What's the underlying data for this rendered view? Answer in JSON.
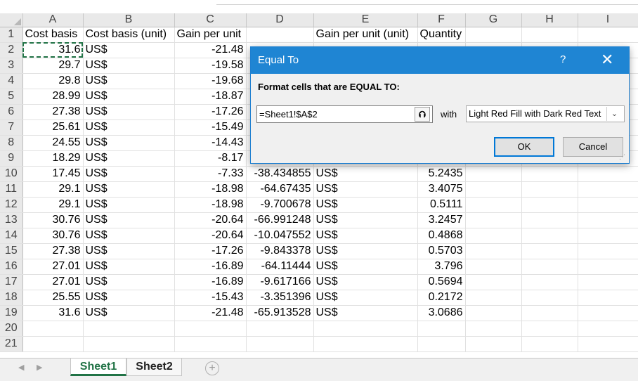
{
  "sheet": {
    "columns": [
      "A",
      "B",
      "C",
      "D",
      "E",
      "F",
      "G",
      "H",
      "I"
    ],
    "rows": [
      {
        "n": "1",
        "a": "Cost basis",
        "b": "Cost basis (unit)",
        "c": "Gain per unit",
        "d": "",
        "e": "Gain per unit (unit)",
        "f": "Quantity"
      },
      {
        "n": "2",
        "a": "31.6",
        "b": "US$",
        "c": "-21.48",
        "d": "",
        "e": "",
        "f": ""
      },
      {
        "n": "3",
        "a": "29.7",
        "b": "US$",
        "c": "-19.58",
        "d": "",
        "e": "",
        "f": ""
      },
      {
        "n": "4",
        "a": "29.8",
        "b": "US$",
        "c": "-19.68",
        "d": "",
        "e": "",
        "f": ""
      },
      {
        "n": "5",
        "a": "28.99",
        "b": "US$",
        "c": "-18.87",
        "d": "",
        "e": "",
        "f": ""
      },
      {
        "n": "6",
        "a": "27.38",
        "b": "US$",
        "c": "-17.26",
        "d": "",
        "e": "",
        "f": ""
      },
      {
        "n": "7",
        "a": "25.61",
        "b": "US$",
        "c": "-15.49",
        "d": "",
        "e": "",
        "f": ""
      },
      {
        "n": "8",
        "a": "24.55",
        "b": "US$",
        "c": "-14.43",
        "d": "",
        "e": "",
        "f": ""
      },
      {
        "n": "9",
        "a": "18.29",
        "b": "US$",
        "c": "-8.17",
        "d": "",
        "e": "",
        "f": ""
      },
      {
        "n": "10",
        "a": "17.45",
        "b": "US$",
        "c": "-7.33",
        "d": "-38.434855",
        "e": "US$",
        "f": "5.2435"
      },
      {
        "n": "11",
        "a": "29.1",
        "b": "US$",
        "c": "-18.98",
        "d": "-64.67435",
        "e": "US$",
        "f": "3.4075"
      },
      {
        "n": "12",
        "a": "29.1",
        "b": "US$",
        "c": "-18.98",
        "d": "-9.700678",
        "e": "US$",
        "f": "0.5111"
      },
      {
        "n": "13",
        "a": "30.76",
        "b": "US$",
        "c": "-20.64",
        "d": "-66.991248",
        "e": "US$",
        "f": "3.2457"
      },
      {
        "n": "14",
        "a": "30.76",
        "b": "US$",
        "c": "-20.64",
        "d": "-10.047552",
        "e": "US$",
        "f": "0.4868"
      },
      {
        "n": "15",
        "a": "27.38",
        "b": "US$",
        "c": "-17.26",
        "d": "-9.843378",
        "e": "US$",
        "f": "0.5703"
      },
      {
        "n": "16",
        "a": "27.01",
        "b": "US$",
        "c": "-16.89",
        "d": "-64.11444",
        "e": "US$",
        "f": "3.796"
      },
      {
        "n": "17",
        "a": "27.01",
        "b": "US$",
        "c": "-16.89",
        "d": "-9.617166",
        "e": "US$",
        "f": "0.5694"
      },
      {
        "n": "18",
        "a": "25.55",
        "b": "US$",
        "c": "-15.43",
        "d": "-3.351396",
        "e": "US$",
        "f": "0.2172"
      },
      {
        "n": "19",
        "a": "31.6",
        "b": "US$",
        "c": "-21.48",
        "d": "-65.913528",
        "e": "US$",
        "f": "3.0686"
      },
      {
        "n": "20",
        "a": "",
        "b": "",
        "c": "",
        "d": "",
        "e": "",
        "f": ""
      },
      {
        "n": "21",
        "a": "",
        "b": "",
        "c": "",
        "d": "",
        "e": "",
        "f": ""
      }
    ]
  },
  "tabs": {
    "sheet1": "Sheet1",
    "sheet2": "Sheet2",
    "add_icon": "+",
    "prev_icon": "◀",
    "next_icon": "▶"
  },
  "dialog": {
    "title": "Equal To",
    "help": "?",
    "close": "✕",
    "prompt": "Format cells that are EQUAL TO:",
    "reference_value": "=Sheet1!$A$2",
    "collapse_icon": "⮉",
    "with_label": "with",
    "format_value": "Light Red Fill with Dark Red Text",
    "dropdown_icon": "⌄",
    "ok_label": "OK",
    "cancel_label": "Cancel"
  },
  "colors": {
    "accent": "#1f85d3",
    "sheet_tab_active": "#217346",
    "selection_border": "#217346"
  }
}
